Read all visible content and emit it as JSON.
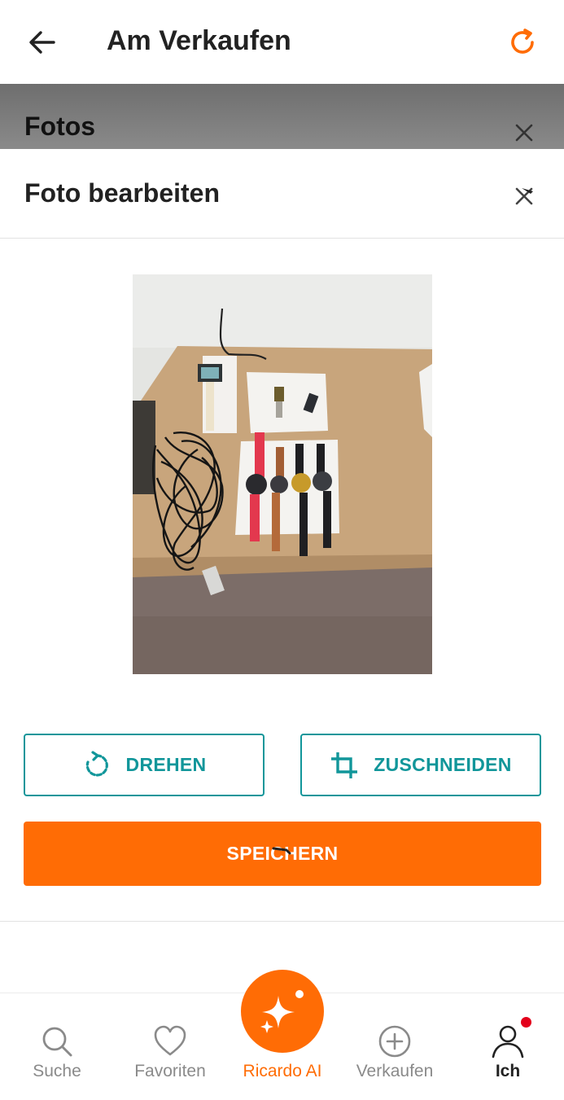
{
  "appbar": {
    "title": "Am Verkaufen",
    "back_icon": "arrow-left-icon",
    "refresh_icon": "refresh-icon"
  },
  "background_sheet": {
    "title": "Fotos",
    "close_icon": "close-icon"
  },
  "editor": {
    "title": "Foto bearbeiten",
    "close_icon": "close-icon",
    "photo_icon": "photo-watches-on-table",
    "rotate_label": "DREHEN",
    "crop_label": "ZUSCHNEIDEN",
    "save_label": "SPEICHERN"
  },
  "bottom_nav": {
    "items": [
      {
        "label": "Suche",
        "icon": "search-icon"
      },
      {
        "label": "Favoriten",
        "icon": "heart-icon"
      },
      {
        "label": "Ricardo AI",
        "icon": "sparkle-icon"
      },
      {
        "label": "Verkaufen",
        "icon": "plus-circle-icon"
      },
      {
        "label": "Ich",
        "icon": "user-icon"
      }
    ]
  },
  "colors": {
    "accent_orange": "#ff6c05",
    "teal": "#11969a",
    "notification": "#e3001b"
  }
}
